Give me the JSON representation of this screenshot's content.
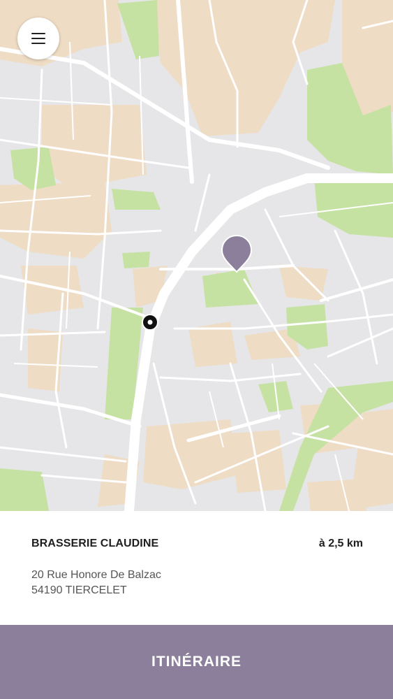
{
  "map": {
    "menu_icon": "hamburger-menu-icon",
    "destination_marker_icon": "map-pin-icon",
    "current_location_icon": "location-dot-icon",
    "colors": {
      "block": "#e6e6e8",
      "road": "#ffffff",
      "park": "#c6e2a3",
      "building": "#efdcc4",
      "pin": "#8b7f9b",
      "location_dot": "#111111"
    }
  },
  "place": {
    "name": "BRASSERIE CLAUDINE",
    "distance": "à 2,5 km",
    "address_line1": "20 Rue Honore De Balzac",
    "address_line2": "54190 TIERCELET"
  },
  "actions": {
    "route_label": "ITINÉRAIRE",
    "route_color": "#8b7f9b"
  }
}
